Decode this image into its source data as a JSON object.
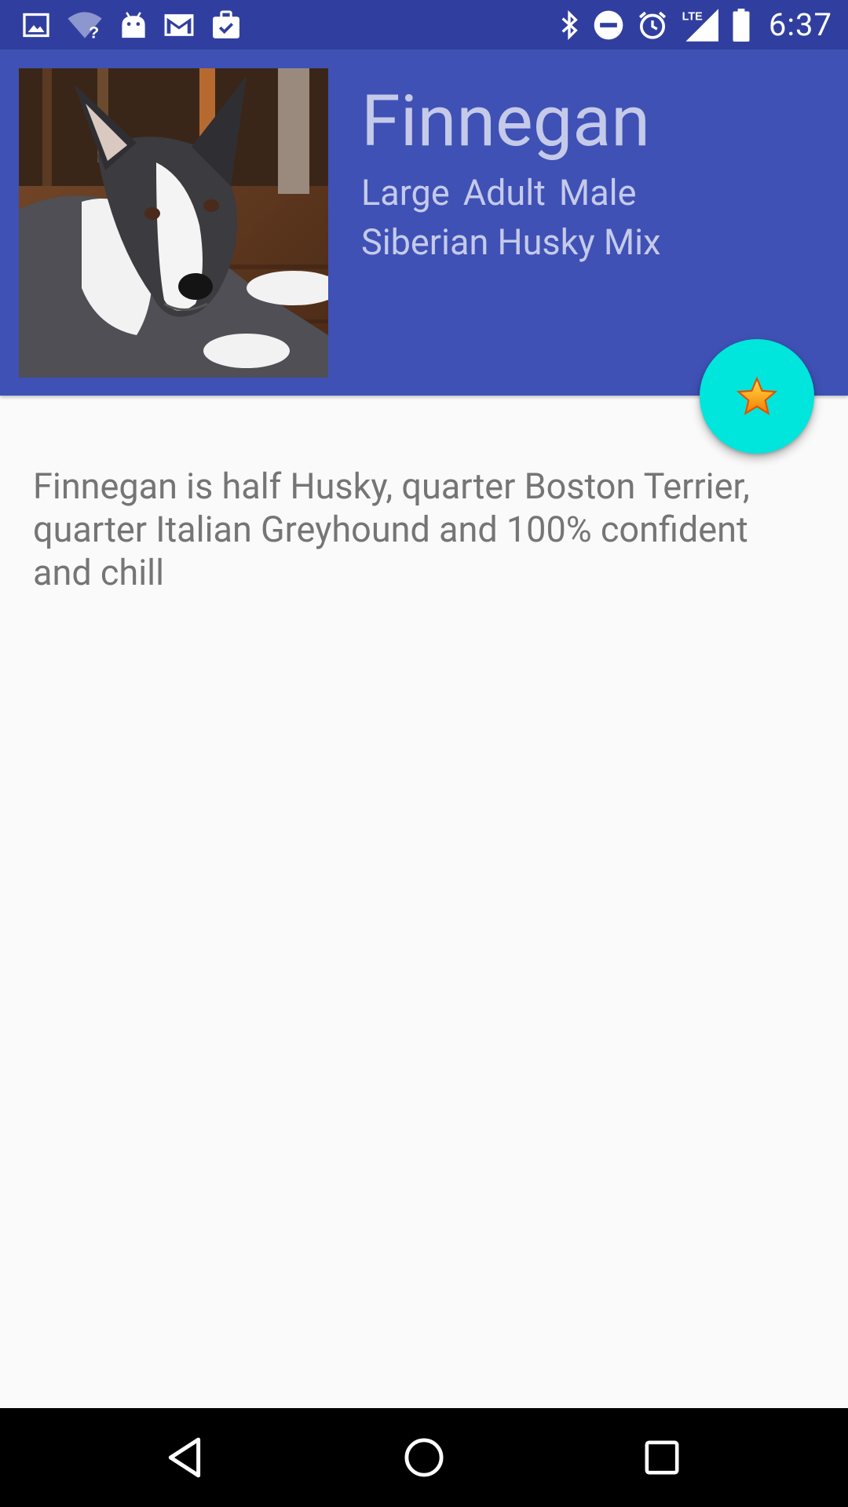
{
  "status_bar": {
    "time": "6:37",
    "icons": [
      "image-icon",
      "wifi-unknown-icon",
      "android-icon",
      "gmail-icon",
      "clipboard-check-icon",
      "bluetooth-icon",
      "do-not-disturb-icon",
      "alarm-icon",
      "lte-signal-icon",
      "battery-icon"
    ],
    "network_label": "LTE"
  },
  "pet": {
    "name": "Finnegan",
    "size": "Large",
    "age": "Adult",
    "sex": "Male",
    "breed": "Siberian Husky Mix",
    "description": "Finnegan is half Husky, quarter Boston Terrier, quarter Italian Greyhound and 100% confident and chill"
  },
  "fab": {
    "icon": "star-icon"
  },
  "nav_bar": {
    "icons": [
      "back-icon",
      "home-icon",
      "recents-icon"
    ]
  },
  "colors": {
    "primary": "#3f51b5",
    "primary_dark": "#303f9f",
    "accent": "#00e5dc",
    "header_text": "#c5cae9",
    "body_text": "#757575",
    "background": "#fafafa"
  }
}
